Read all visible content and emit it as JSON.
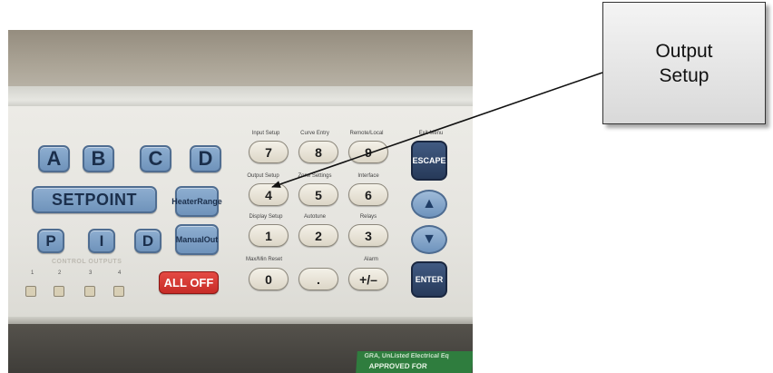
{
  "callout": {
    "line1": "Output",
    "line2": "Setup"
  },
  "letter_keys": [
    "A",
    "B",
    "C",
    "D"
  ],
  "pid_keys": [
    "P",
    "I",
    "D"
  ],
  "setpoint_label": "SETPOINT",
  "heater_range": {
    "line1": "Heater",
    "line2": "Range"
  },
  "manual_out": {
    "line1": "Manual",
    "line2": "Out"
  },
  "control_outputs": {
    "title": "CONTROL OUTPUTS",
    "numbers": [
      "1",
      "2",
      "3",
      "4"
    ]
  },
  "all_off_label": "ALL OFF",
  "keypad": {
    "rows": [
      {
        "labels": [
          "Input Setup",
          "Curve Entry",
          "Remote/Local"
        ],
        "keys": [
          "7",
          "8",
          "9"
        ]
      },
      {
        "labels": [
          "Output Setup",
          "Zone Settings",
          "Interface"
        ],
        "keys": [
          "4",
          "5",
          "6"
        ]
      },
      {
        "labels": [
          "Display Setup",
          "Autotune",
          "Relays"
        ],
        "keys": [
          "1",
          "2",
          "3"
        ]
      },
      {
        "labels": [
          "Max/Min Reset",
          "",
          "Alarm"
        ],
        "keys": [
          "0",
          ".",
          "+/–"
        ]
      }
    ]
  },
  "exit_menu_label": "Exit Menu",
  "escape_label": "ESCAPE",
  "enter_label": "ENTER",
  "up_arrow": "▲",
  "down_arrow": "▼",
  "sticker": {
    "line1": "GRA, UnListed Electrical Eq",
    "line2": "APPROVED FOR"
  },
  "colors": {
    "blue_key": "#7ea0c8",
    "red_key": "#d83a34",
    "dark_key": "#2f4468",
    "panel": "#e8e7e2"
  }
}
